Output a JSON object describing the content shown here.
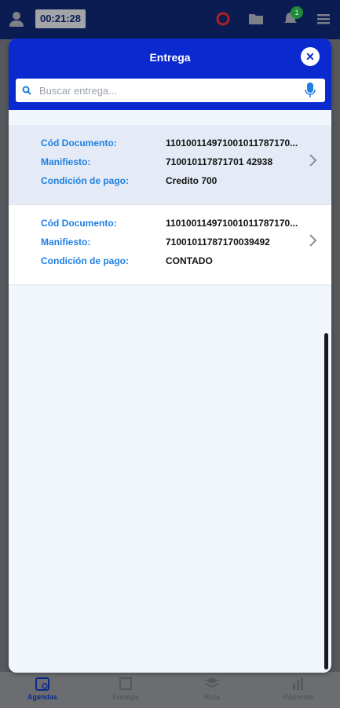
{
  "app": {
    "timer": "00:21:28",
    "notification_count": "1",
    "bottom_nav": [
      {
        "label": "Agendas",
        "icon": "calendar-icon",
        "active": true
      },
      {
        "label": "Entrega",
        "icon": "delivery-icon",
        "active": false
      },
      {
        "label": "Ruta",
        "icon": "layers-icon",
        "active": false
      },
      {
        "label": "Reportes",
        "icon": "chart-icon",
        "active": false
      }
    ]
  },
  "modal": {
    "title": "Entrega",
    "close_icon": "close-icon",
    "search": {
      "placeholder": "Buscar entrega...",
      "value": "",
      "icon": "search-icon",
      "mic_icon": "microphone-icon"
    },
    "items": [
      {
        "doc_label": "Cód Documento:",
        "doc_value": "110100114971001011787170...",
        "manifest_label": "Manifiesto:",
        "manifest_value": "710010117871701 42938",
        "payment_label": "Condición de pago:",
        "payment_value": "Credito 700",
        "selected": true
      },
      {
        "doc_label": "Cód Documento:",
        "doc_value": "110100114971001011787170...",
        "manifest_label": "Manifiesto:",
        "manifest_value": "71001011787170039492",
        "payment_label": "Condición de pago:",
        "payment_value": "CONTADO",
        "selected": false
      }
    ]
  },
  "colors": {
    "accent": "#0a2ad0",
    "label": "#1f7fe0",
    "header_dark": "#0b1c52",
    "modal_bg": "#f1f6fd"
  }
}
